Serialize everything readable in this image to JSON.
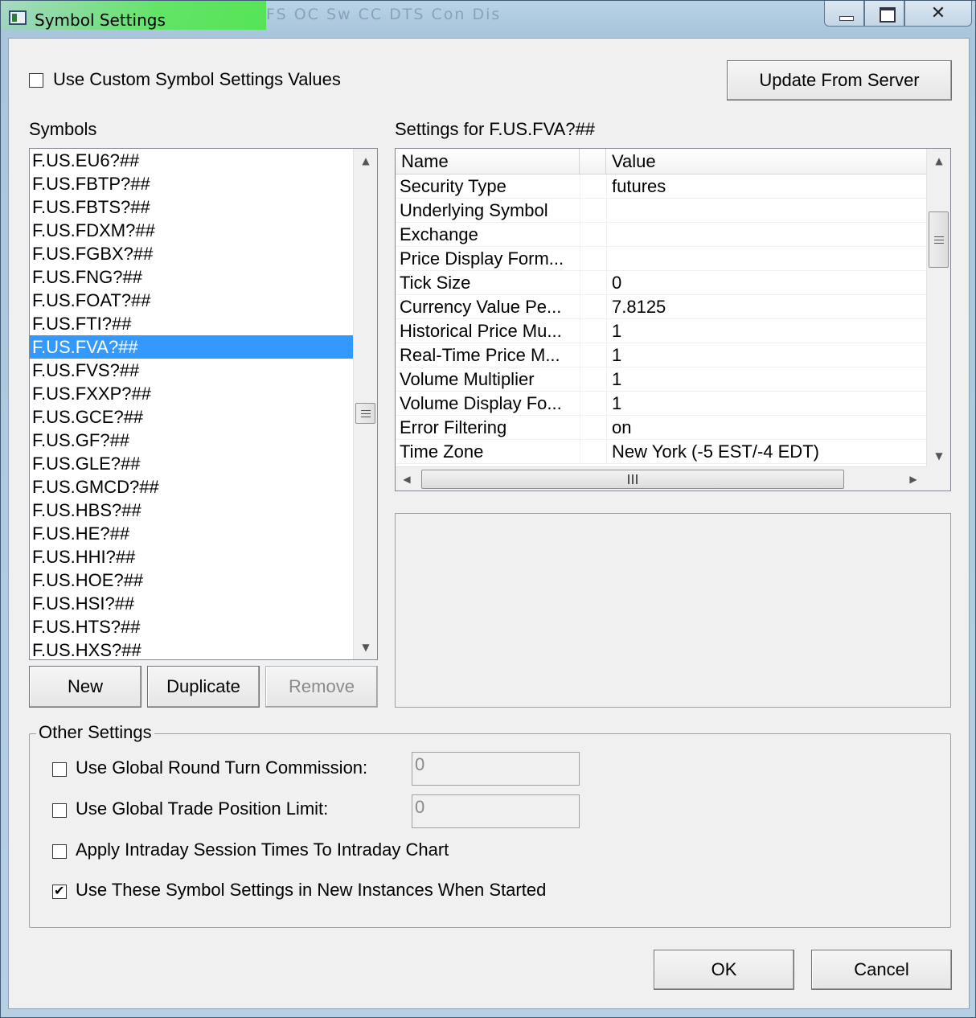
{
  "window": {
    "title": "Symbol Settings",
    "background_ghost": "FS OC Sw CC DTS Con Dis"
  },
  "top": {
    "use_custom_label": "Use Custom Symbol Settings Values",
    "use_custom_checked": false,
    "update_button": "Update From Server"
  },
  "symbols": {
    "heading": "Symbols",
    "selected": "F.US.FVA?##",
    "items": [
      "F.US.EU6?##",
      "F.US.FBTP?##",
      "F.US.FBTS?##",
      "F.US.FDXM?##",
      "F.US.FGBX?##",
      "F.US.FNG?##",
      "F.US.FOAT?##",
      "F.US.FTI?##",
      "F.US.FVA?##",
      "F.US.FVS?##",
      "F.US.FXXP?##",
      "F.US.GCE?##",
      "F.US.GF?##",
      "F.US.GLE?##",
      "F.US.GMCD?##",
      "F.US.HBS?##",
      "F.US.HE?##",
      "F.US.HHI?##",
      "F.US.HOE?##",
      "F.US.HSI?##",
      "F.US.HTS?##",
      "F.US.HXS?##"
    ],
    "buttons": {
      "new": "New",
      "duplicate": "Duplicate",
      "remove": "Remove"
    }
  },
  "settings": {
    "heading": "Settings for F.US.FVA?##",
    "columns": {
      "name": "Name",
      "value": "Value"
    },
    "rows": [
      {
        "name": "Security Type",
        "value": "futures"
      },
      {
        "name": "Underlying Symbol",
        "value": ""
      },
      {
        "name": "Exchange",
        "value": ""
      },
      {
        "name": "Price Display Form...",
        "value": ""
      },
      {
        "name": "Tick Size",
        "value": "0"
      },
      {
        "name": "Currency Value Pe...",
        "value": "7.8125"
      },
      {
        "name": "Historical Price Mu...",
        "value": "1"
      },
      {
        "name": "Real-Time Price M...",
        "value": "1"
      },
      {
        "name": "Volume Multiplier",
        "value": "1"
      },
      {
        "name": "Volume Display Fo...",
        "value": "1"
      },
      {
        "name": "Error Filtering",
        "value": "on"
      },
      {
        "name": "Time Zone",
        "value": "New York (-5 EST/-4 EDT)"
      }
    ]
  },
  "other": {
    "title": "Other Settings",
    "round_turn_label": "Use Global Round Turn Commission:",
    "round_turn_value": "0",
    "round_turn_checked": false,
    "position_limit_label": "Use Global Trade Position Limit:",
    "position_limit_value": "0",
    "position_limit_checked": false,
    "session_times_label": "Apply Intraday Session Times To Intraday Chart",
    "session_times_checked": false,
    "new_instances_label": "Use These Symbol Settings in New Instances When Started",
    "new_instances_checked": true
  },
  "footer": {
    "ok": "OK",
    "cancel": "Cancel"
  },
  "colors": {
    "selection": "#3399ff",
    "face": "#f0f0f0",
    "title_glow": "#50e650"
  }
}
